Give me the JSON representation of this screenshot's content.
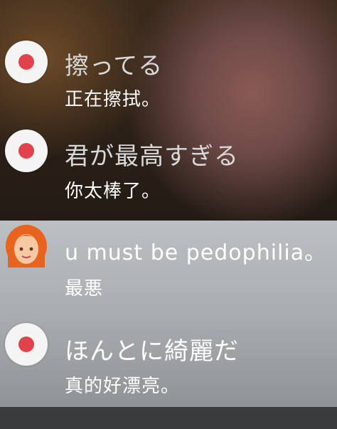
{
  "comments": [
    {
      "avatar": "red-dot-icon",
      "original": "擦ってる",
      "translation": "正在擦拭。"
    },
    {
      "avatar": "red-dot-icon",
      "original": "君が最高すぎる",
      "translation": "你太棒了。"
    },
    {
      "avatar": "woman-face-emoji-icon",
      "original": "u must be pedophilia。",
      "translation": "最悪"
    },
    {
      "avatar": "red-dot-icon",
      "original": "ほんとに綺麗だ",
      "translation": "真的好漂亮。"
    }
  ],
  "colors": {
    "dot": "#e2424b",
    "bottom_bar": "#3a3b3c"
  }
}
